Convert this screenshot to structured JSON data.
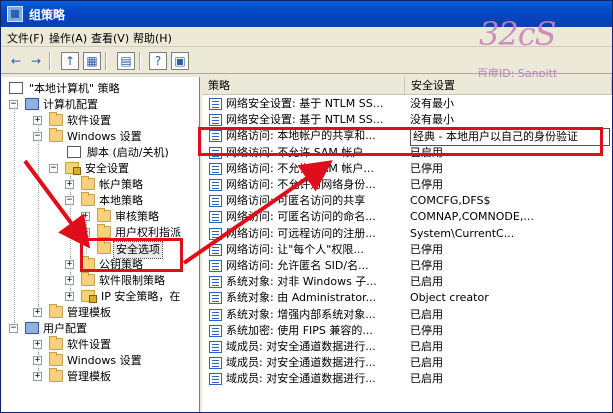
{
  "window": {
    "title": "组策略"
  },
  "menu": {
    "items": [
      "文件(F)",
      "操作(A)",
      "查看(V)",
      "帮助(H)"
    ]
  },
  "toolbar": {
    "icons": [
      "back-arrow-icon",
      "forward-arrow-icon",
      "up-folder-icon",
      "show-tree-icon",
      "export-list-icon",
      "properties-icon",
      "help-icon"
    ]
  },
  "watermark": {
    "logo": "32cS",
    "id_text": "百度ID: Sanpitt"
  },
  "tree": {
    "root": "\"本地计算机\" 策略",
    "computer_config": "计算机配置",
    "software_settings": "软件设置",
    "windows_settings": "Windows 设置",
    "scripts": "脚本 (启动/关机)",
    "security_settings": "安全设置",
    "account_policies": "帐户策略",
    "local_policies": "本地策略",
    "audit_policy": "审核策略",
    "user_rights": "用户权利指派",
    "security_options": "安全选项",
    "public_key_policies": "公钥策略",
    "software_restriction": "软件限制策略",
    "ip_security": "IP 安全策略，在",
    "admin_templates": "管理模板",
    "user_config": "用户配置",
    "user_software_settings": "软件设置",
    "user_windows_settings": "Windows 设置",
    "user_admin_templates": "管理模板"
  },
  "list": {
    "columns": {
      "policy": "策略",
      "setting": "安全设置"
    },
    "rows": [
      {
        "policy": "网络安全设置: 基于 NTLM SS...",
        "setting": "没有最小"
      },
      {
        "policy": "网络安全设置: 基于 NTLM SS...",
        "setting": "没有最小"
      },
      {
        "policy": "网络访问: 本地帐户的共享和...",
        "setting": "经典 - 本地用户以自己的身份验证"
      },
      {
        "policy": "网络访问: 不允许 SAM 帐户...",
        "setting": "已启用"
      },
      {
        "policy": "网络访问: 不允许 SAM 帐户...",
        "setting": "已停用"
      },
      {
        "policy": "网络访问: 不允许为网络身份...",
        "setting": "已停用"
      },
      {
        "policy": "网络访问: 可匿名访问的共享",
        "setting": "COMCFG,DFS$"
      },
      {
        "policy": "网络访问: 可匿名访问的命名...",
        "setting": "COMNAP,COMNODE,..."
      },
      {
        "policy": "网络访问: 可远程访问的注册...",
        "setting": "System\\CurrentC..."
      },
      {
        "policy": "网络访问: 让\"每个人\"权限...",
        "setting": "已停用"
      },
      {
        "policy": "网络访问: 允许匿名 SID/名...",
        "setting": "已停用"
      },
      {
        "policy": "系统对象: 对非 Windows 子...",
        "setting": "已启用"
      },
      {
        "policy": "系统对象: 由 Administrator...",
        "setting": "Object creator"
      },
      {
        "policy": "系统对象: 增强内部系统对象...",
        "setting": "已启用"
      },
      {
        "policy": "系统加密: 使用 FIPS 兼容的...",
        "setting": "已停用"
      },
      {
        "policy": "域成员: 对安全通道数据进行...",
        "setting": "已启用"
      },
      {
        "policy": "域成员: 对安全通道数据进行...",
        "setting": "已启用"
      },
      {
        "policy": "域成员: 对安全通道数据进行...",
        "setting": "已启用"
      }
    ]
  },
  "colors": {
    "annotation_red": "#e00d1a",
    "title_blue": "#0348c8"
  }
}
